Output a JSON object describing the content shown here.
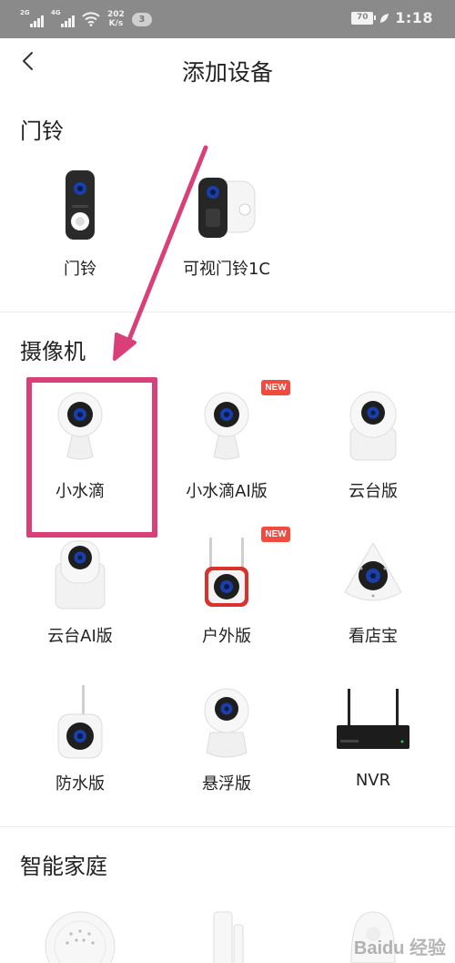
{
  "status_bar": {
    "sim1_label": "2G",
    "sim2_label": "4G",
    "speed_value": "202",
    "speed_unit": "K/s",
    "notification_count": "3",
    "battery_level": "70",
    "time": "1:18"
  },
  "header": {
    "title": "添加设备"
  },
  "sections": {
    "doorbell": {
      "title": "门铃",
      "items": [
        "门铃",
        "可视门铃1C"
      ]
    },
    "camera": {
      "title": "摄像机",
      "items": [
        "小水滴",
        "小水滴AI版",
        "云台版",
        "云台AI版",
        "户外版",
        "看店宝",
        "防水版",
        "悬浮版",
        "NVR"
      ],
      "new_badge": "NEW"
    },
    "smart_home": {
      "title": "智能家庭"
    }
  },
  "watermark": {
    "text": "Baidu 经验"
  },
  "colors": {
    "highlight": "#d9407a",
    "badge": "#ef4b3f",
    "status_bar_bg": "#8a8a8a"
  }
}
